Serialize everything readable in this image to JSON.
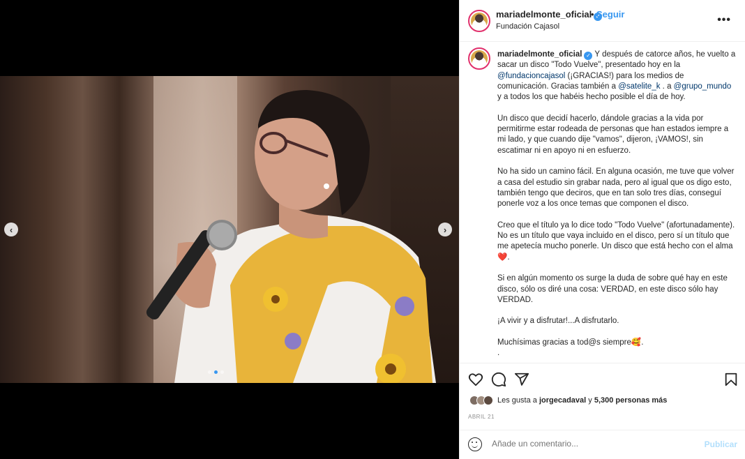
{
  "post": {
    "username": "mariadelmonte_oficial",
    "dot": "•",
    "follow_label": "Seguir",
    "location": "Fundación Cajasol",
    "more_label": "•••"
  },
  "caption": {
    "username": "mariadelmonte_oficial",
    "p1_a": " Y después de catorce años, he vuelto a sacar un disco \"Todo Vuelve\", presentado hoy en la ",
    "mention1": "@fundacioncajasol",
    "p1_b": " (¡GRACIAS!) para los medios de comunicación. Gracias también a ",
    "mention2": "@satelite_k",
    "p1_c": " . a ",
    "mention3": "@grupo_mundo",
    "p1_d": " y a todos los que habéis hecho posible el día de hoy.",
    "p2": "Un disco que decidí hacerlo, dándole gracias a la vida por permitirme estar rodeada de personas que han estados iempre a mi lado, y que cuando dije \"vamos\", dijeron, ¡VAMOS!, sin escatimar ni en apoyo ni en esfuerzo.",
    "p3": "No ha sido un camino fácil. En alguna ocasión, me tuve que volver a casa del estudio sin grabar nada, pero al igual que os digo esto, también tengo que deciros, que en tan solo tres días, conseguí ponerle voz a los once temas que componen el disco.",
    "p4": "Creo que el título ya lo dice todo \"Todo Vuelve\" (afortunadamente). No es un título que vaya incluido en el disco, pero sí un título que me apetecía mucho ponerle. Un disco que está hecho con el alma ❤️.",
    "p5": "Si en algún momento os surge la duda de sobre qué hay en este disco, sólo os diré una cosa: VERDAD, en este disco sólo hay VERDAD.",
    "p6": "¡A vivir y a disfrutar!...A disfrutarlo.",
    "p7": "Muchísimas gracias a tod@s siempre🥰.",
    "p8": ".\n."
  },
  "likes": {
    "prefix": "Les gusta a ",
    "user": "jorgecadaval",
    "mid": " y ",
    "count": "5,300 personas más"
  },
  "date": "ABRIL 21",
  "comment": {
    "placeholder": "Añade un comentario...",
    "post_label": "Publicar"
  },
  "carousel": {
    "prev": "‹",
    "next": "›",
    "slides": 3,
    "active": 1
  },
  "colors": {
    "accent": "#3897f0",
    "mention": "#00376b",
    "muted": "#8e8e8e"
  }
}
